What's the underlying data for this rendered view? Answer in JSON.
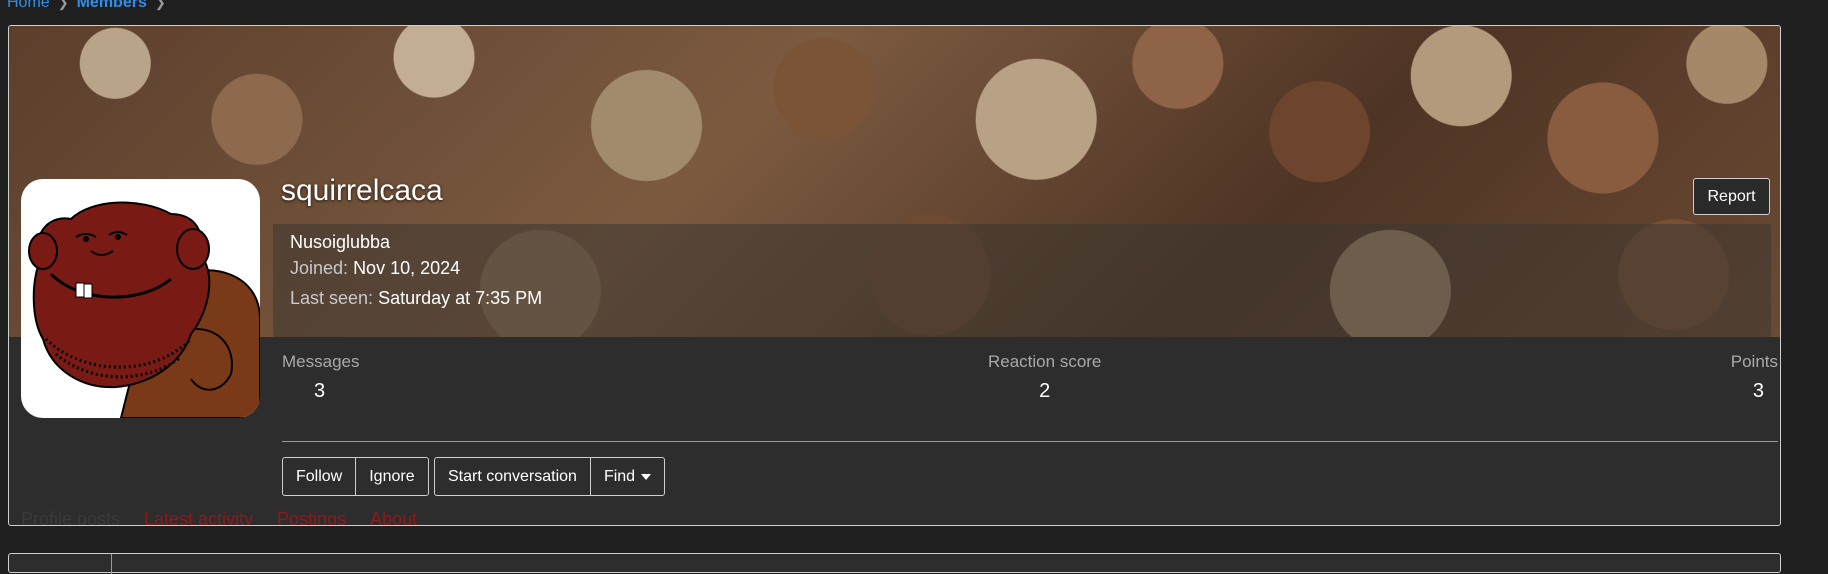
{
  "breadcrumb": {
    "items": [
      {
        "label": "Home"
      },
      {
        "label": "Members"
      }
    ]
  },
  "profile": {
    "username": "squirrelcaca",
    "user_title": "Nusoiglubba",
    "joined_label": "Joined:",
    "joined_value": "Nov 10, 2024",
    "last_seen_label": "Last seen:",
    "last_seen_value": "Saturday at 7:35 PM",
    "report_label": "Report"
  },
  "stats": [
    {
      "label": "Messages",
      "value": "3"
    },
    {
      "label": "Reaction score",
      "value": "2"
    },
    {
      "label": "Points",
      "value": "3"
    }
  ],
  "actions": {
    "follow": "Follow",
    "ignore": "Ignore",
    "start_conversation": "Start conversation",
    "find": "Find"
  },
  "tabs": [
    {
      "label": "Profile posts",
      "active": true
    },
    {
      "label": "Latest activity",
      "active": false
    },
    {
      "label": "Postings",
      "active": false
    },
    {
      "label": "About",
      "active": false
    }
  ],
  "colors": {
    "link": "#2f8ee6",
    "tab_text": "#8c1a1a",
    "tab_active_underline": "#b01e1e",
    "panel_bg": "#2d2d2d",
    "page_bg": "#1f1f1f",
    "avatar_skin": "#7a1a14",
    "avatar_body": "#7a3a18"
  }
}
